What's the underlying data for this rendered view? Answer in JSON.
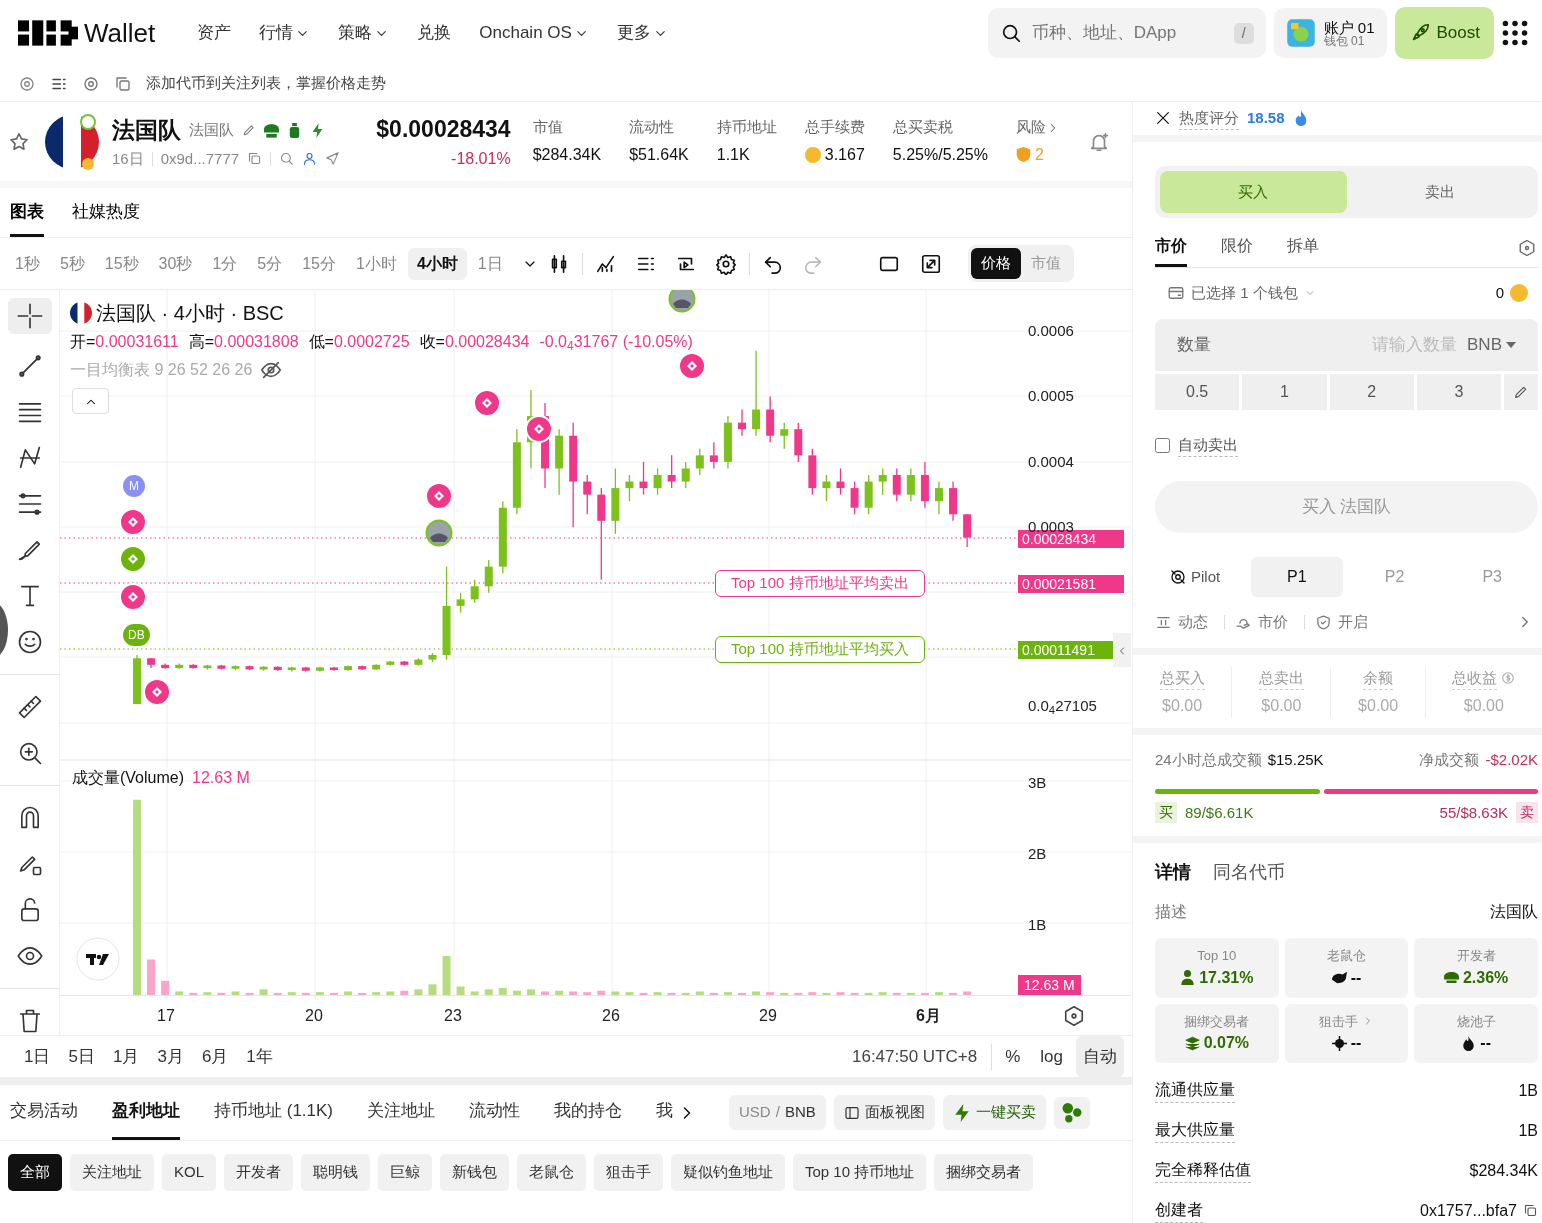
{
  "nav": {
    "logo_text": "Wallet",
    "items": [
      {
        "label": "资产",
        "dropdown": false
      },
      {
        "label": "行情",
        "dropdown": true
      },
      {
        "label": "策略",
        "dropdown": true
      },
      {
        "label": "兑换",
        "dropdown": false
      },
      {
        "label": "Onchain OS",
        "dropdown": true
      },
      {
        "label": "更多",
        "dropdown": true
      }
    ],
    "search": {
      "placeholder": "币种、地址、DApp",
      "shortcut": "/"
    },
    "account": {
      "name": "账户 01",
      "wallet": "钱包 01"
    },
    "boost": "Boost"
  },
  "watch_bar": {
    "text": "添加代币到关注列表，掌握价格走势"
  },
  "token": {
    "name": "法国队",
    "subname": "法国队",
    "age": "16日",
    "address": "0x9d...7777",
    "price": "$0.00028434",
    "change": "-18.01%",
    "stats": [
      {
        "label": "市值",
        "value": "$284.34K",
        "kind": "plain"
      },
      {
        "label": "流动性",
        "value": "$51.64K",
        "kind": "plain"
      },
      {
        "label": "持币地址",
        "value": "1.1K",
        "kind": "plain"
      },
      {
        "label": "总手续费",
        "value": "3.167",
        "kind": "coin"
      },
      {
        "label": "总买卖税",
        "value": "5.25%/5.25%",
        "kind": "plain"
      },
      {
        "label": "风险",
        "value": "2",
        "kind": "risk"
      }
    ]
  },
  "view_tabs": [
    {
      "label": "图表",
      "selected": true
    },
    {
      "label": "社媒热度",
      "selected": false
    }
  ],
  "intervals": [
    {
      "label": "1秒",
      "selected": false
    },
    {
      "label": "5秒",
      "selected": false
    },
    {
      "label": "15秒",
      "selected": false
    },
    {
      "label": "30秒",
      "selected": false
    },
    {
      "label": "1分",
      "selected": false
    },
    {
      "label": "5分",
      "selected": false
    },
    {
      "label": "15分",
      "selected": false
    },
    {
      "label": "1小时",
      "selected": false
    },
    {
      "label": "4小时",
      "selected": true
    },
    {
      "label": "1日",
      "selected": false
    }
  ],
  "chart_mode": [
    {
      "label": "价格",
      "selected": true
    },
    {
      "label": "市值",
      "selected": false
    }
  ],
  "chart": {
    "legend_title": "法国队 · 4小时 · BSC",
    "ohlc": [
      {
        "label": "开=",
        "value": "0.00031611"
      },
      {
        "label": "高=",
        "value": "0.00031808"
      },
      {
        "label": "低=",
        "value": "0.0002725"
      },
      {
        "label": "收=",
        "value": "0.00028434"
      }
    ],
    "change": "-0.0$_{4}$31767 (-10.05%)",
    "indicator": "一目均衡表 9 26 52 26 26",
    "chart_data": {
      "type": "candlestick",
      "categories": [
        null,
        null,
        null,
        null,
        null,
        null,
        null,
        null,
        null,
        null,
        null,
        null,
        null,
        null,
        null,
        null,
        null,
        null,
        null,
        null,
        null,
        null,
        null,
        null,
        null,
        null,
        null,
        null,
        null,
        null,
        null,
        null,
        null,
        null,
        null,
        null,
        null,
        null,
        null,
        null,
        null,
        null,
        null,
        null,
        null,
        null,
        null,
        null,
        null,
        null,
        null,
        null,
        null,
        null,
        null,
        null,
        null,
        null,
        null,
        null
      ],
      "ylim": [
        2.7105e-05,
        0.0006
      ],
      "ohlc": [
        [
          3e-05,
          0.000105,
          3e-05,
          0.0001
        ],
        [
          0.0001,
          0.0001,
          8.5e-05,
          9e-05
        ],
        [
          9e-05,
          9.2e-05,
          8.4e-05,
          8.5e-05
        ],
        [
          8.5e-05,
          9.2e-05,
          8.4e-05,
          9e-05
        ],
        [
          9e-05,
          9.1e-05,
          8.4e-05,
          8.5e-05
        ],
        [
          8.5e-05,
          9e-05,
          8.3e-05,
          8.9e-05
        ],
        [
          8.9e-05,
          9e-05,
          8.3e-05,
          8.4e-05
        ],
        [
          8.4e-05,
          8.9e-05,
          8.2e-05,
          8.8e-05
        ],
        [
          8.8e-05,
          8.9e-05,
          8.2e-05,
          8.3e-05
        ],
        [
          8.3e-05,
          8.8e-05,
          8.1e-05,
          8.7e-05
        ],
        [
          8.7e-05,
          8.8e-05,
          8.1e-05,
          8.2e-05
        ],
        [
          8.2e-05,
          8.7e-05,
          8e-05,
          8.6e-05
        ],
        [
          8.6e-05,
          8.7e-05,
          8e-05,
          8.1e-05
        ],
        [
          8.1e-05,
          8.7e-05,
          8e-05,
          8.6e-05
        ],
        [
          8.6e-05,
          8.7e-05,
          8.1e-05,
          8.2e-05
        ],
        [
          8.2e-05,
          8.9e-05,
          8.1e-05,
          8.8e-05
        ],
        [
          8.8e-05,
          8.9e-05,
          8.2e-05,
          8.3e-05
        ],
        [
          8.3e-05,
          9.1e-05,
          8.2e-05,
          9e-05
        ],
        [
          9e-05,
          9.6e-05,
          8.9e-05,
          9.5e-05
        ],
        [
          9.5e-05,
          9.6e-05,
          8.9e-05,
          9e-05
        ],
        [
          9e-05,
          0.0001,
          8.9e-05,
          9.8e-05
        ],
        [
          9.8e-05,
          0.000108,
          9.4e-05,
          0.000105
        ],
        [
          0.000105,
          0.00024,
          9.8e-05,
          0.00018
        ],
        [
          0.00018,
          0.0002,
          0.00017,
          0.00019
        ],
        [
          0.00019,
          0.00022,
          0.000185,
          0.00021
        ],
        [
          0.00021,
          0.00025,
          0.0002,
          0.00024
        ],
        [
          0.00024,
          0.00034,
          0.00023,
          0.00033
        ],
        [
          0.00033,
          0.00045,
          0.00032,
          0.00043
        ],
        [
          0.00043,
          0.00051,
          0.00039,
          0.00047
        ],
        [
          0.00047,
          0.00049,
          0.00036,
          0.00039
        ],
        [
          0.00039,
          0.00045,
          0.00035,
          0.00044
        ],
        [
          0.00044,
          0.00046,
          0.0003,
          0.00037
        ],
        [
          0.00037,
          0.00038,
          0.00032,
          0.00035
        ],
        [
          0.00035,
          0.00036,
          0.00022,
          0.00031
        ],
        [
          0.00031,
          0.00039,
          0.00029,
          0.00036
        ],
        [
          0.00036,
          0.00038,
          0.00034,
          0.00037
        ],
        [
          0.00037,
          0.0004,
          0.00035,
          0.00036
        ],
        [
          0.00036,
          0.00039,
          0.00035,
          0.00038
        ],
        [
          0.00038,
          0.00041,
          0.00036,
          0.00037
        ],
        [
          0.00037,
          0.0004,
          0.00036,
          0.00039
        ],
        [
          0.00039,
          0.00042,
          0.00038,
          0.00041
        ],
        [
          0.00041,
          0.00043,
          0.00039,
          0.0004
        ],
        [
          0.0004,
          0.00047,
          0.00039,
          0.00046
        ],
        [
          0.00046,
          0.00048,
          0.00044,
          0.00045
        ],
        [
          0.00045,
          0.00057,
          0.00044,
          0.00048
        ],
        [
          0.00048,
          0.0005,
          0.00043,
          0.00044
        ],
        [
          0.00044,
          0.00046,
          0.00042,
          0.00045
        ],
        [
          0.00045,
          0.00046,
          0.0004,
          0.00041
        ],
        [
          0.00041,
          0.00042,
          0.00035,
          0.00036
        ],
        [
          0.00036,
          0.00038,
          0.00034,
          0.00037
        ],
        [
          0.00037,
          0.00039,
          0.00035,
          0.00036
        ],
        [
          0.00036,
          0.00037,
          0.00032,
          0.00033
        ],
        [
          0.00033,
          0.00038,
          0.00032,
          0.00037
        ],
        [
          0.00037,
          0.00039,
          0.00035,
          0.00038
        ],
        [
          0.00038,
          0.00039,
          0.00034,
          0.00035
        ],
        [
          0.00035,
          0.00039,
          0.00034,
          0.00038
        ],
        [
          0.00038,
          0.0004,
          0.00033,
          0.00034
        ],
        [
          0.00034,
          0.00037,
          0.00032,
          0.00036
        ],
        [
          0.00036,
          0.00037,
          0.00031,
          0.00032
        ],
        [
          0.00032,
          0.00032,
          0.00027,
          0.00028434
        ]
      ],
      "yticks": [
        {
          "value": 0.0006,
          "label": "0.0006"
        },
        {
          "value": 0.0005,
          "label": "0.0005"
        },
        {
          "value": 0.0004,
          "label": "0.0004"
        },
        {
          "value": 0.0003,
          "label": "0.0003"
        },
        {
          "value": 2.7105e-05,
          "label": "0.0$_{4}$27105"
        }
      ]
    },
    "price_tags": [
      {
        "value": "0.00028434",
        "color": "#f0388a"
      },
      {
        "value": "0.00021581",
        "color": "#f0388a"
      },
      {
        "value": "0.00011491",
        "color": "#6cb40c"
      }
    ],
    "lines": [
      {
        "label": "Top 100 持币地址平均卖出",
        "color": "#f0388a"
      },
      {
        "label": "Top 100 持币地址平均买入",
        "color": "#6cb40c"
      }
    ],
    "markers": [
      {
        "kind": "letter",
        "label": "M",
        "color": "#8a8ff5"
      },
      {
        "kind": "trade",
        "color": "#f0388a"
      },
      {
        "kind": "trade",
        "color": "#6cb40c"
      },
      {
        "kind": "trade",
        "color": "#f0388a"
      },
      {
        "kind": "letter",
        "label": "DB",
        "color": "#6cb40c"
      },
      {
        "kind": "trade",
        "color": "#f0388a"
      },
      {
        "kind": "avatar"
      },
      {
        "kind": "trade",
        "color": "#f0388a"
      },
      {
        "kind": "trade",
        "color": "#f0388a"
      },
      {
        "kind": "trade",
        "color": "#f0388a"
      },
      {
        "kind": "avatar"
      },
      {
        "kind": "trade",
        "color": "#f0388a"
      }
    ],
    "volume": {
      "label": "成交量(Volume)",
      "value": "12.63 M",
      "tag": "12.63 M",
      "chart_data": {
        "type": "bar",
        "categories": [
          null,
          null,
          null,
          null,
          null,
          null,
          null,
          null,
          null,
          null,
          null,
          null,
          null,
          null,
          null,
          null,
          null,
          null,
          null,
          null,
          null,
          null,
          null,
          null,
          null,
          null,
          null,
          null,
          null,
          null,
          null,
          null,
          null,
          null,
          null,
          null,
          null,
          null,
          null,
          null,
          null,
          null,
          null,
          null,
          null,
          null,
          null,
          null,
          null,
          null,
          null,
          null,
          null,
          null,
          null,
          null,
          null,
          null,
          null,
          null
        ],
        "ylim": [
          0,
          3
        ],
        "values": [
          2.75,
          0.5,
          0.2,
          0.05,
          0.03,
          0.04,
          0.03,
          0.05,
          0.03,
          0.08,
          0.03,
          0.04,
          0.03,
          0.04,
          0.03,
          0.05,
          0.03,
          0.04,
          0.05,
          0.06,
          0.08,
          0.15,
          0.55,
          0.12,
          0.05,
          0.08,
          0.1,
          0.06,
          0.08,
          0.05,
          0.06,
          0.05,
          0.04,
          0.06,
          0.05,
          0.04,
          0.03,
          0.04,
          0.03,
          0.03,
          0.05,
          0.03,
          0.04,
          0.03,
          0.05,
          0.04,
          0.03,
          0.03,
          0.04,
          0.03,
          0.04,
          0.03,
          0.03,
          0.04,
          0.03,
          0.03,
          0.03,
          0.04,
          0.03,
          0.05
        ],
        "yticks": [
          {
            "value": 3,
            "label": "3B"
          },
          {
            "value": 2,
            "label": "2B"
          },
          {
            "value": 1,
            "label": "1B"
          }
        ]
      }
    },
    "x_axis": [
      {
        "label": "17",
        "bold": false
      },
      {
        "label": "20",
        "bold": false
      },
      {
        "label": "23",
        "bold": false
      },
      {
        "label": "26",
        "bold": false
      },
      {
        "label": "29",
        "bold": false
      },
      {
        "label": "6月",
        "bold": true
      }
    ]
  },
  "range_bar": {
    "ranges": [
      "1日",
      "5日",
      "1月",
      "3月",
      "6月",
      "1年"
    ],
    "time": "16:47:50 UTC+8",
    "options": [
      {
        "label": "%",
        "selected": false
      },
      {
        "label": "log",
        "selected": false
      },
      {
        "label": "自动",
        "selected": true
      }
    ]
  },
  "bottom_tabs": [
    {
      "label": "交易活动",
      "selected": false
    },
    {
      "label": "盈利地址",
      "selected": true
    },
    {
      "label": "持币地址 (1.1K)",
      "selected": false
    },
    {
      "label": "关注地址",
      "selected": false
    },
    {
      "label": "流动性",
      "selected": false
    },
    {
      "label": "我的持仓",
      "selected": false
    },
    {
      "label": "我",
      "selected": false
    }
  ],
  "currency": {
    "base": "USD",
    "separator": "/",
    "quote": "BNB"
  },
  "panel_view": "面板视图",
  "quick_trade": "一键买卖",
  "filters": [
    {
      "label": "全部",
      "selected": true
    },
    {
      "label": "关注地址",
      "selected": false
    },
    {
      "label": "KOL",
      "selected": false
    },
    {
      "label": "开发者",
      "selected": false
    },
    {
      "label": "聪明钱",
      "selected": false
    },
    {
      "label": "巨鲸",
      "selected": false
    },
    {
      "label": "新钱包",
      "selected": false
    },
    {
      "label": "老鼠仓",
      "selected": false
    },
    {
      "label": "狙击手",
      "selected": false
    },
    {
      "label": "疑似钓鱼地址",
      "selected": false
    },
    {
      "label": "Top 10 持币地址",
      "selected": false
    },
    {
      "label": "捆绑交易者",
      "selected": false
    }
  ],
  "heat": {
    "label": "热度评分",
    "score": "18.58"
  },
  "trade": {
    "sides": [
      {
        "label": "买入",
        "selected": true
      },
      {
        "label": "卖出",
        "selected": false
      }
    ],
    "order_types": [
      {
        "label": "市价",
        "selected": true
      },
      {
        "label": "限价",
        "selected": false
      },
      {
        "label": "拆单",
        "selected": false
      }
    ],
    "wallet": "已选择 1 个钱包",
    "balance": "0",
    "amount": {
      "label": "数量",
      "placeholder": "请输入数量",
      "unit": "BNB"
    },
    "presets": [
      "0.5",
      "1",
      "2",
      "3"
    ],
    "auto_sell": {
      "label": "自动卖出",
      "checked": false
    },
    "submit": {
      "label": "买入 法国队",
      "disabled": true
    },
    "pilot": "Pilot",
    "profiles": [
      {
        "label": "P1",
        "selected": true
      },
      {
        "label": "P2",
        "selected": false
      },
      {
        "label": "P3",
        "selected": false
      }
    ],
    "settings": [
      "动态",
      "市价",
      "开启"
    ]
  },
  "pnl": [
    {
      "label": "总买入",
      "value": "$0.00"
    },
    {
      "label": "总卖出",
      "value": "$0.00"
    },
    {
      "label": "余额",
      "value": "$0.00"
    },
    {
      "label": "总收益",
      "value": "$0.00"
    }
  ],
  "volume24h": {
    "label": "24小时总成交额",
    "value": "$15.25K",
    "net_label": "净成交额",
    "net_value": "-$2.02K",
    "level": 0.43,
    "buy_tag": "买",
    "buy": "89/$6.61K",
    "sell": "55/$8.63K",
    "sell_tag": "卖"
  },
  "details": {
    "tabs": [
      {
        "label": "详情",
        "selected": true
      },
      {
        "label": "同名代币",
        "selected": false
      }
    ],
    "description_label": "描述",
    "description": "法国队",
    "holders": [
      {
        "label": "Top 10",
        "value": "17.31%",
        "kind": "positive",
        "link": false
      },
      {
        "label": "老鼠仓",
        "value": "--",
        "kind": "neutral",
        "link": false
      },
      {
        "label": "开发者",
        "value": "2.36%",
        "kind": "positive",
        "link": false
      },
      {
        "label": "捆绑交易者",
        "value": "0.07%",
        "kind": "positive",
        "link": false
      },
      {
        "label": "狙击手",
        "value": "--",
        "kind": "neutral",
        "link": true
      },
      {
        "label": "烧池子",
        "value": "--",
        "kind": "neutral",
        "link": false
      }
    ],
    "rows": [
      {
        "label": "流通供应量",
        "value": "1B",
        "copy": false
      },
      {
        "label": "最大供应量",
        "value": "1B",
        "copy": false
      },
      {
        "label": "完全稀释估值",
        "value": "$284.34K",
        "copy": false
      },
      {
        "label": "创建者",
        "value": "0x1757...bfa7",
        "copy": true
      }
    ]
  }
}
